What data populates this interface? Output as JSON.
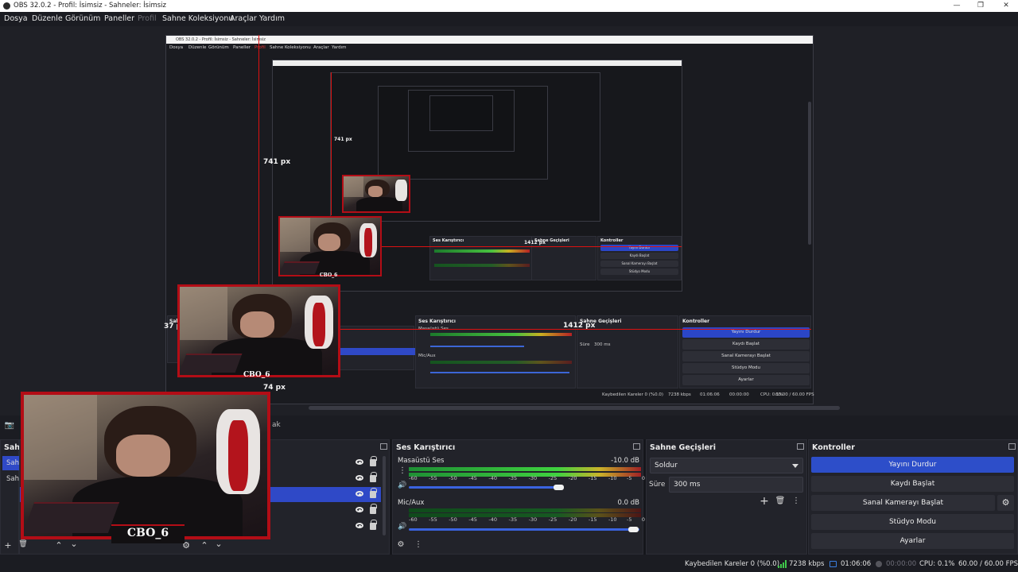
{
  "window": {
    "title": "OBS 32.0.2 - Profil: İsimsiz - Sahneler: İsimsiz",
    "minimize": "—",
    "maximize": "❐",
    "close": "✕"
  },
  "menu": {
    "items": [
      "Dosya",
      "Düzenle",
      "Görünüm",
      "Paneller",
      "Profil",
      "Sahne Koleksiyonu",
      "Araçlar",
      "Yardım"
    ]
  },
  "preview": {
    "nested_title": "OBS 32.0.2 - Profil: İsimsiz - Sahneler: İsimsiz",
    "label_741": "741 px",
    "label_741_small": "741 px",
    "label_1412": "1412 px",
    "label_1412_small": "1412 px",
    "label_37": "37 px",
    "label_74": "74 px",
    "cam_name": "CBO_6",
    "nested_docks": {
      "audio": "Ses Karıştırıcı",
      "transitions": "Sahne Geçişleri",
      "controls": "Kontroller",
      "scenes": "Sah",
      "desktop": "Masaüstü Ses",
      "mic": "Mic/Aux",
      "duration_label": "Süre",
      "duration": "300 ms",
      "buttons": [
        "Yayını Durdur",
        "Kaydı Başlat",
        "Sanal Kamerayı Başlat",
        "Stüdyo Modu",
        "Ayarlar"
      ],
      "status": "Kaybedilen Kareler 0 (%0.0)",
      "kbps": "7238 kbps",
      "time": "01:06:06",
      "rec": "00:00:00",
      "cpu": "CPU: 0.1%",
      "fps": "60.00 / 60.00 FPS"
    }
  },
  "scenes": {
    "title": "Sah",
    "items": [
      "Sah",
      "Sah"
    ]
  },
  "sources": {
    "partial_label": "ak"
  },
  "audio": {
    "title": "Ses Karıştırıcı",
    "tracks": [
      {
        "name": "Masaüstü Ses",
        "db": "-10.0 dB",
        "level": 0.8,
        "volume": 0.9
      },
      {
        "name": "Mic/Aux",
        "db": "0.0 dB",
        "level": 0.0,
        "volume": 1.0
      }
    ],
    "scale": [
      "-60",
      "-55",
      "-50",
      "-45",
      "-40",
      "-35",
      "-30",
      "-25",
      "-20",
      "-15",
      "-10",
      "-5",
      "0"
    ]
  },
  "transitions": {
    "title": "Sahne Geçişleri",
    "selected": "Soldur",
    "duration_label": "Süre",
    "duration_value": "300 ms"
  },
  "controls": {
    "title": "Kontroller",
    "stop_stream": "Yayını Durdur",
    "start_record": "Kaydı Başlat",
    "start_virtualcam": "Sanal Kamerayı Başlat",
    "studio_mode": "Stüdyo Modu",
    "settings": "Ayarlar"
  },
  "status": {
    "dropped_frames": "Kaybedilen Kareler 0 (%0.0)",
    "bitrate": "7238 kbps",
    "stream_time": "01:06:06",
    "record_time": "00:00:00",
    "cpu": "CPU: 0.1%",
    "fps": "60.00 / 60.00 FPS"
  },
  "icons": {
    "gear": "⚙",
    "plus": "+",
    "trash": "🗑",
    "more": "⋮",
    "up": "⌃",
    "down": "⌄",
    "camera": "📷",
    "speaker": "🔊"
  },
  "colors": {
    "accent_blue": "#2d4ec9",
    "brand_red": "#b30d16",
    "meter_green": "#3fd23f"
  }
}
